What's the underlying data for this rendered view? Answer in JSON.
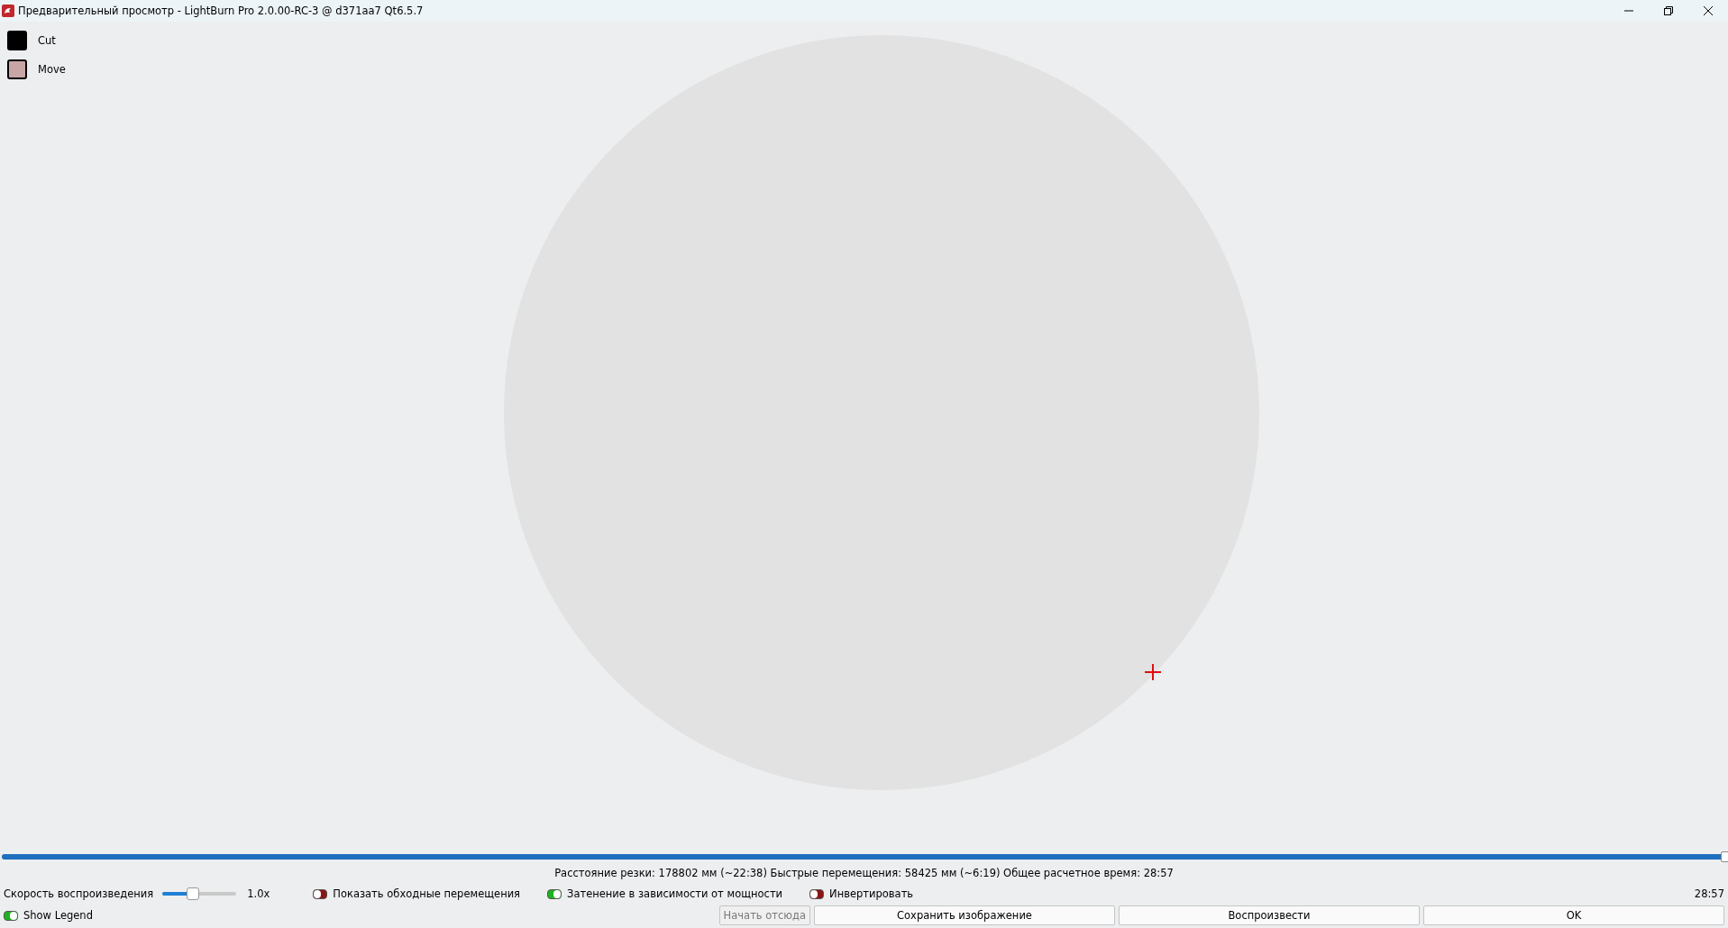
{
  "window": {
    "title": "Предварительный просмотр - LightBurn Pro 2.0.00-RC-3 @ d371aa7 Qt6.5.7"
  },
  "legend": [
    {
      "label": "Cut",
      "color": "#000000"
    },
    {
      "label": "Move",
      "color": "#c9a6a6"
    }
  ],
  "progress": {
    "level": 1.0
  },
  "stats": "Расстояние резки: 178802 мм (~22:38) Быстрые перемещения: 58425 мм (~6:19) Общее расчетное время: 28:57",
  "speed": {
    "label": "Скорость воспроизведения",
    "level": 0.4,
    "reading": "1.0x"
  },
  "toggles": [
    {
      "label": "Показать обходные перемещения",
      "on": false
    },
    {
      "label": "Затенение в зависимости от мощности",
      "on": true
    },
    {
      "label": "Инвертировать",
      "on": false
    }
  ],
  "time": "28:57",
  "show_legend": {
    "label": "Show Legend",
    "on": true
  },
  "buttons": [
    {
      "label": "Начать отсюда",
      "disabled": true
    },
    {
      "label": "Сохранить изображение",
      "disabled": false
    },
    {
      "label": "Воспроизвести",
      "disabled": false
    },
    {
      "label": "OK",
      "disabled": false
    }
  ]
}
